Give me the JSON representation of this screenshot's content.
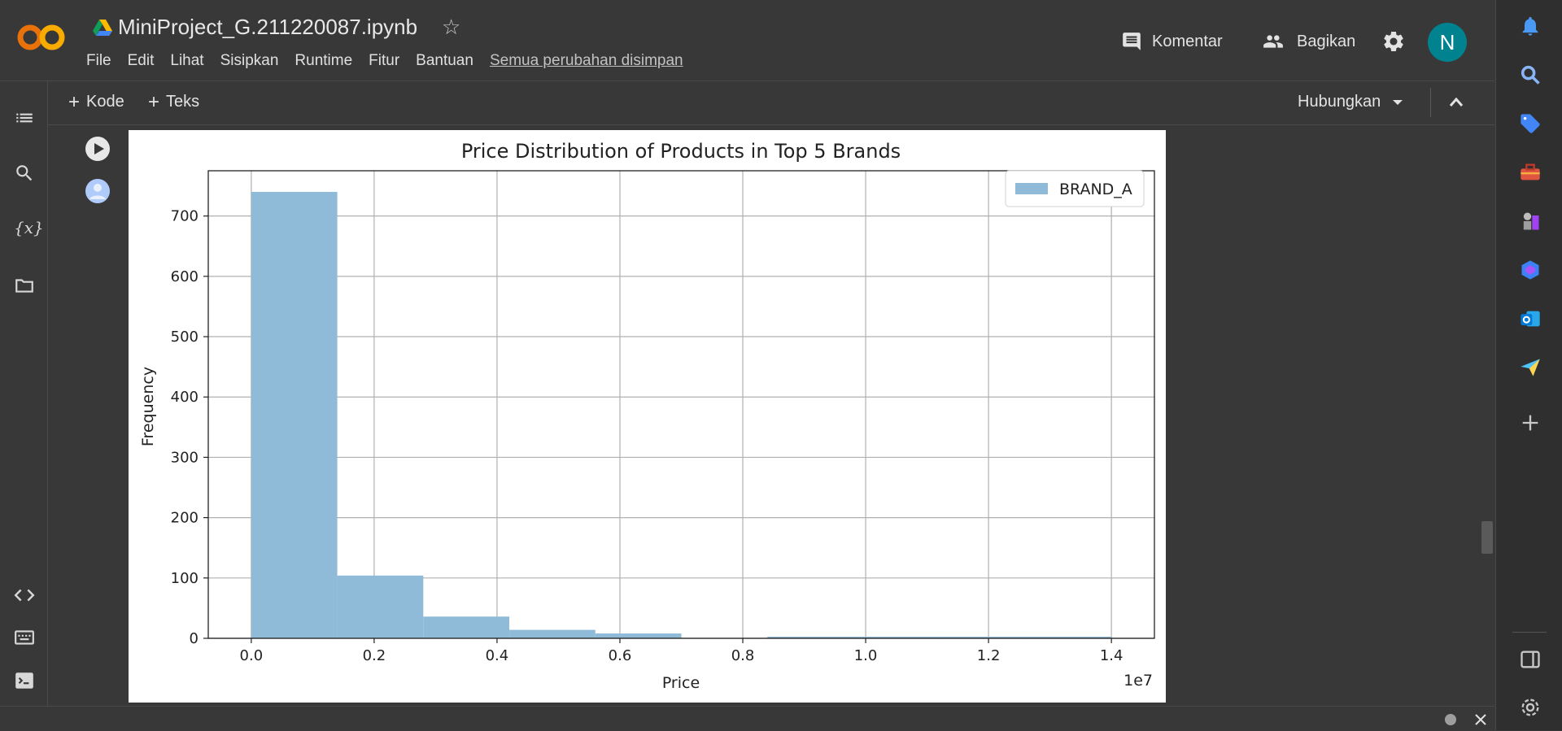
{
  "header": {
    "notebook_title": "MiniProject_G.211220087.ipynb",
    "menu": [
      "File",
      "Edit",
      "Lihat",
      "Sisipkan",
      "Runtime",
      "Fitur",
      "Bantuan"
    ],
    "saved_status": "Semua perubahan disimpan",
    "comment_label": "Komentar",
    "share_label": "Bagikan",
    "avatar_letter": "N"
  },
  "toolbar": {
    "add_code_label": "Kode",
    "add_text_label": "Teks",
    "connect_label": "Hubungkan"
  },
  "icons": {
    "left_rail": [
      "toc-icon",
      "search-icon",
      "variables-icon",
      "folder-icon",
      "code-snippets-icon",
      "command-palette-icon",
      "terminal-icon"
    ],
    "right_rail": [
      "bell-icon",
      "search-icon",
      "tag-icon",
      "toolbox-icon",
      "chess-icon",
      "copilot-icon",
      "outlook-icon",
      "send-icon",
      "plus-icon",
      "panel-icon",
      "gear-icon"
    ]
  },
  "colors": {
    "background": "#383838",
    "accent": "#f9ab00",
    "avatar_bg": "#00838f",
    "bar_fill": "#8fbbd9"
  },
  "chart_data": {
    "type": "bar",
    "title": "Price Distribution of Products in Top 5 Brands",
    "xlabel": "Price",
    "ylabel": "Frequency",
    "x_offset_label": "1e7",
    "xlim": [
      -0.07,
      1.47
    ],
    "ylim": [
      0,
      775
    ],
    "xticks": [
      0.0,
      0.2,
      0.4,
      0.6,
      0.8,
      1.0,
      1.2,
      1.4
    ],
    "xtick_labels": [
      "0.0",
      "0.2",
      "0.4",
      "0.6",
      "0.8",
      "1.0",
      "1.2",
      "1.4"
    ],
    "yticks": [
      0,
      100,
      200,
      300,
      400,
      500,
      600,
      700
    ],
    "ytick_labels": [
      "0",
      "100",
      "200",
      "300",
      "400",
      "500",
      "600",
      "700"
    ],
    "grid": true,
    "legend_position": "top-right",
    "series": [
      {
        "name": "BRAND_A",
        "bin_edges": [
          0.0,
          0.14,
          0.28,
          0.42,
          0.56,
          0.7,
          0.84,
          0.98,
          1.12,
          1.26,
          1.4
        ],
        "values": [
          740,
          104,
          36,
          14,
          8,
          0,
          1,
          1,
          1,
          1
        ]
      }
    ]
  }
}
